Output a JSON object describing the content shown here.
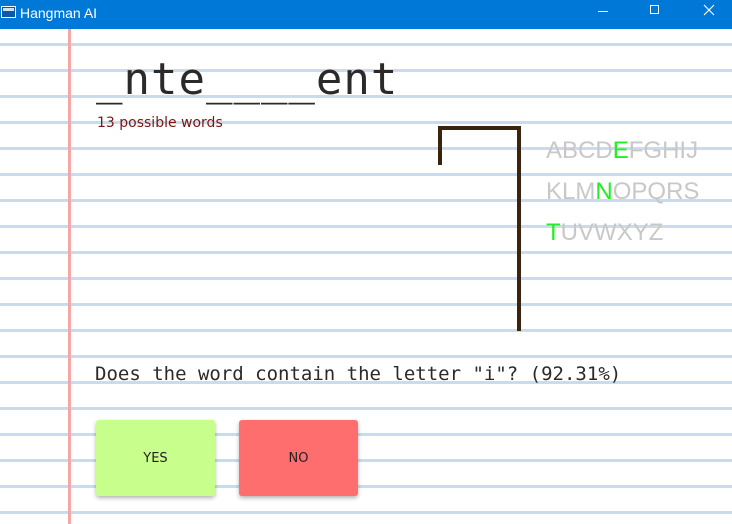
{
  "window": {
    "title": "Hangman AI"
  },
  "game": {
    "word_pattern": "_nte____ent",
    "possible_words": "13 possible words",
    "question": "Does the word contain the letter \"i\"? (92.31%)"
  },
  "alphabet": {
    "rows": [
      [
        {
          "l": "A",
          "g": false
        },
        {
          "l": "B",
          "g": false
        },
        {
          "l": "C",
          "g": false
        },
        {
          "l": "D",
          "g": false
        },
        {
          "l": "E",
          "g": true
        },
        {
          "l": "F",
          "g": false
        },
        {
          "l": "G",
          "g": false
        },
        {
          "l": "H",
          "g": false
        },
        {
          "l": "I",
          "g": false
        },
        {
          "l": "J",
          "g": false
        }
      ],
      [
        {
          "l": "K",
          "g": false
        },
        {
          "l": "L",
          "g": false
        },
        {
          "l": "M",
          "g": false
        },
        {
          "l": "N",
          "g": true
        },
        {
          "l": "O",
          "g": false
        },
        {
          "l": "P",
          "g": false
        },
        {
          "l": "Q",
          "g": false
        },
        {
          "l": "R",
          "g": false
        },
        {
          "l": "S",
          "g": false
        }
      ],
      [
        {
          "l": "T",
          "g": true
        },
        {
          "l": "U",
          "g": false
        },
        {
          "l": "V",
          "g": false
        },
        {
          "l": "W",
          "g": false
        },
        {
          "l": "X",
          "g": false
        },
        {
          "l": "Y",
          "g": false
        },
        {
          "l": "Z",
          "g": false
        }
      ]
    ]
  },
  "buttons": {
    "yes": "YES",
    "no": "NO"
  },
  "colors": {
    "titlebar": "#0078d7",
    "guessed_letter": "#22ee22",
    "unguessed_letter": "#c8c8c8",
    "yes_button": "#c8ff8c",
    "no_button": "#ff6e6e",
    "gallows": "#3a2410"
  }
}
